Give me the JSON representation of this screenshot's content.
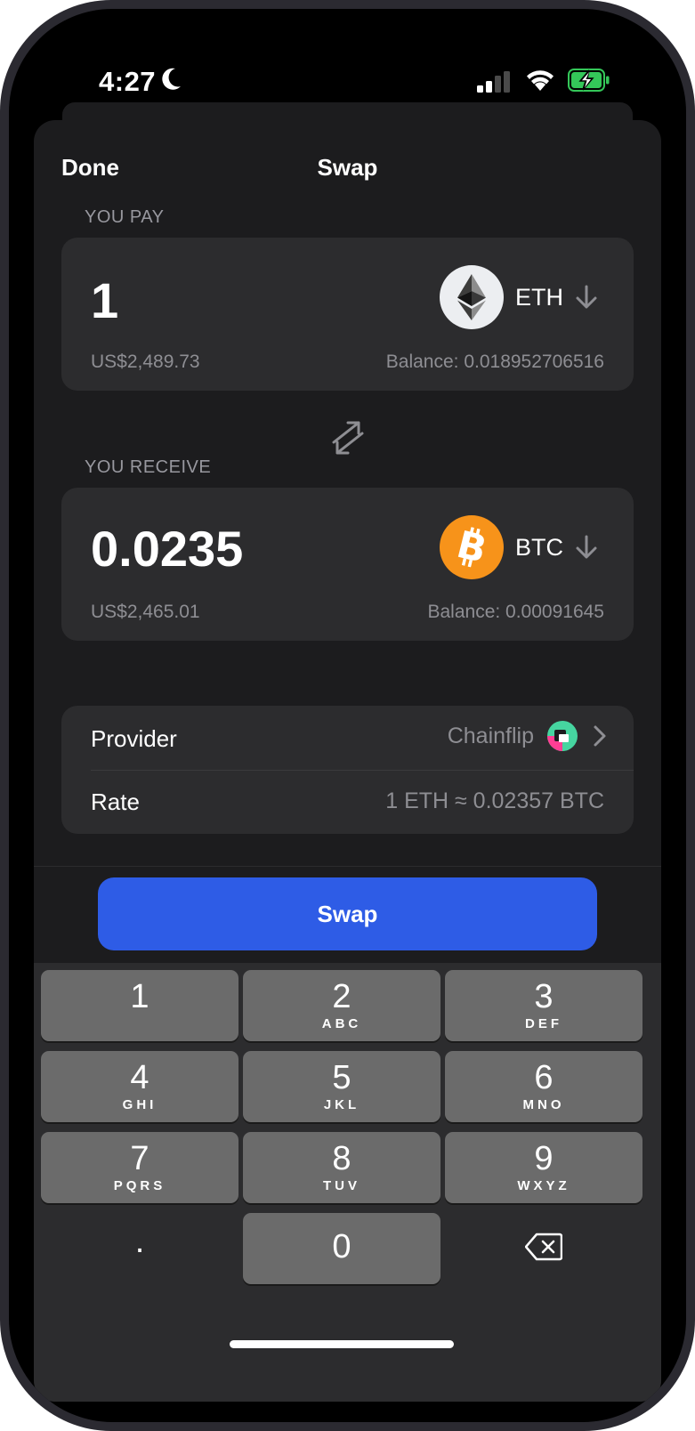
{
  "status_bar": {
    "time": "4:27"
  },
  "nav": {
    "done_label": "Done",
    "title": "Swap"
  },
  "pay": {
    "section_label": "YOU PAY",
    "amount": "1",
    "fiat_value": "US$2,489.73",
    "balance": "Balance: 0.018952706516",
    "token_symbol": "ETH"
  },
  "receive": {
    "section_label": "YOU RECEIVE",
    "amount": "0.0235",
    "fiat_value": "US$2,465.01",
    "balance": "Balance: 0.00091645",
    "token_symbol": "BTC"
  },
  "details": {
    "provider_label": "Provider",
    "provider_value": "Chainflip",
    "rate_label": "Rate",
    "rate_value": "1 ETH ≈ 0.02357 BTC"
  },
  "swap_button_label": "Swap",
  "keypad": {
    "keys": [
      {
        "num": "1",
        "letters": ""
      },
      {
        "num": "2",
        "letters": "ABC"
      },
      {
        "num": "3",
        "letters": "DEF"
      },
      {
        "num": "4",
        "letters": "GHI"
      },
      {
        "num": "5",
        "letters": "JKL"
      },
      {
        "num": "6",
        "letters": "MNO"
      },
      {
        "num": "7",
        "letters": "PQRS"
      },
      {
        "num": "8",
        "letters": "TUV"
      },
      {
        "num": "9",
        "letters": "WXYZ"
      }
    ],
    "decimal": ".",
    "zero": "0",
    "delete_icon": "delete-backspace-icon"
  },
  "colors": {
    "accent": "#2e5ce6",
    "eth_icon_bg": "#eceef1",
    "btc_icon_bg": "#f7931a",
    "battery_green": "#34c759"
  }
}
